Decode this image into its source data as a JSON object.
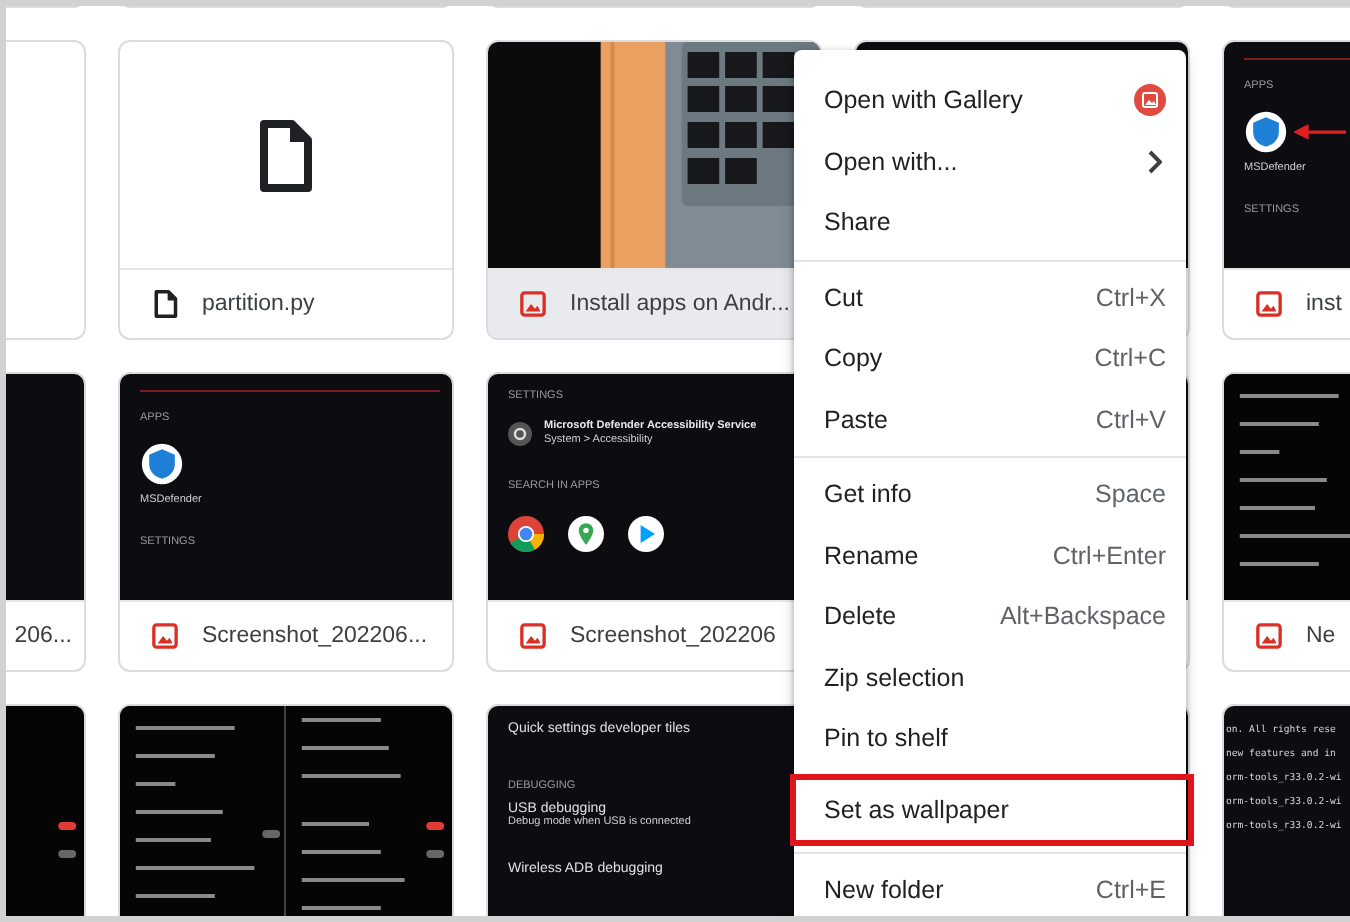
{
  "tiles": [
    {
      "kind": "blank"
    },
    {
      "kind": "file",
      "name": "partition.py",
      "selected": false
    },
    {
      "name": "Install apps on Andr...",
      "selected": true
    },
    {
      "kind": "dark"
    },
    {
      "kind": "apps",
      "name": "inst",
      "selected": false,
      "section": "APPS",
      "app": "MSDefender",
      "footer": "SETTINGS",
      "arrow": true
    },
    {
      "kind": "dark",
      "name": "206...",
      "selected": false
    },
    {
      "kind": "apps",
      "name": "Screenshot_202206...",
      "selected": false,
      "section": "APPS",
      "app": "MSDefender",
      "footer": "SETTINGS",
      "arrow": false
    },
    {
      "kind": "search",
      "name": "Screenshot_202206",
      "selected": false,
      "section": "SETTINGS",
      "title": "Microsoft Defender Accessibility Service",
      "subtitle": "System > Accessibility",
      "footer": "SEARCH IN APPS"
    },
    {
      "kind": "dark"
    },
    {
      "kind": "list",
      "name": "Ne",
      "selected": false
    },
    {
      "kind": "list"
    },
    {
      "kind": "list2"
    },
    {
      "kind": "debug",
      "heading": "Quick settings developer tiles",
      "section": "DEBUGGING",
      "title": "USB debugging",
      "subtitle": "Debug mode when USB is connected",
      "footer": "Wireless ADB debugging"
    },
    {
      "kind": "dark"
    },
    {
      "kind": "terminal",
      "lines": [
        "on. All rights rese",
        "new features and in",
        "orm-tools_r33.0.2-wi",
        "orm-tools_r33.0.2-wi",
        "orm-tools_r33.0.2-wi"
      ]
    }
  ],
  "menu": [
    [
      {
        "label": "Open with Gallery",
        "kind": "app"
      },
      {
        "label": "Open with...",
        "kind": "submenu"
      },
      {
        "label": "Share",
        "kind": "plain"
      }
    ],
    [
      {
        "label": "Cut",
        "kind": "plain",
        "shortcut": "Ctrl+X"
      },
      {
        "label": "Copy",
        "kind": "plain",
        "shortcut": "Ctrl+C"
      },
      {
        "label": "Paste",
        "kind": "plain",
        "shortcut": "Ctrl+V"
      }
    ],
    [
      {
        "label": "Get info",
        "kind": "plain",
        "shortcut": "Space"
      },
      {
        "label": "Rename",
        "kind": "plain",
        "shortcut": "Ctrl+Enter"
      },
      {
        "label": "Delete",
        "kind": "plain",
        "shortcut": "Alt+Backspace"
      },
      {
        "label": "Zip selection",
        "kind": "plain"
      },
      {
        "label": "Pin to shelf",
        "kind": "plain"
      },
      {
        "label": "Set as wallpaper",
        "kind": "plain",
        "highlighted": true
      }
    ],
    [
      {
        "label": "New folder",
        "kind": "plain",
        "shortcut": "Ctrl+E"
      }
    ]
  ]
}
